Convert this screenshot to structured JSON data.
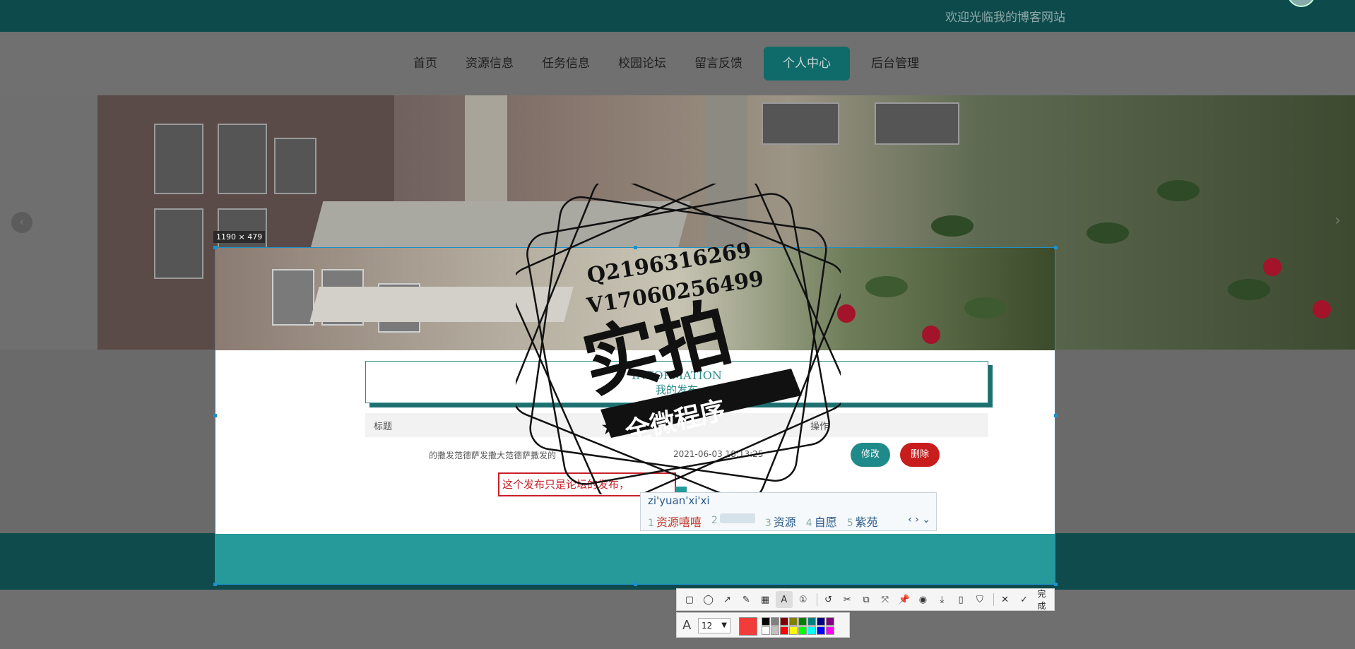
{
  "header": {
    "welcome": "欢迎光临我的博客网站"
  },
  "nav": {
    "items": [
      {
        "label": "首页"
      },
      {
        "label": "资源信息"
      },
      {
        "label": "任务信息"
      },
      {
        "label": "校园论坛"
      },
      {
        "label": "留言反馈"
      },
      {
        "label": "个人中心",
        "active": true
      },
      {
        "label": "后台管理"
      }
    ]
  },
  "selection": {
    "dimensions": "1190 × 479"
  },
  "info": {
    "title_en": "INFORMATION",
    "title_cn": "我的发布"
  },
  "table": {
    "headers": [
      "标题",
      "操作"
    ],
    "row": {
      "title": "的撒发范德萨发撒大范德萨撒发的",
      "date": "2021-06-03 18:13:25",
      "edit_label": "修改",
      "delete_label": "删除"
    }
  },
  "annotation_text": "这个发布只是论坛的发布，",
  "ime": {
    "input": "zi'yuan'xi'xi",
    "candidates": [
      {
        "num": "1",
        "text": "资源嘻嘻"
      },
      {
        "num": "2",
        "text": ""
      },
      {
        "num": "3",
        "text": "资源"
      },
      {
        "num": "4",
        "text": "自愿"
      },
      {
        "num": "5",
        "text": "紫苑"
      }
    ]
  },
  "watermark": {
    "line1": "Q2196316269",
    "line2": "V17060256499",
    "main": "实拍",
    "banner": "全微程序"
  },
  "toolbar": {
    "tools": [
      "rectangle-icon",
      "ellipse-icon",
      "arrow-icon",
      "pen-icon",
      "mosaic-icon",
      "text-icon",
      "number-icon"
    ],
    "actions": [
      "undo-icon",
      "ocr-icon",
      "translate-icon",
      "scroll-capture-icon",
      "pin-icon",
      "record-icon",
      "download-icon",
      "phone-icon",
      "bookmark-icon"
    ],
    "cancel": "close-icon",
    "done_label": "完成"
  },
  "propbar": {
    "font_size": "12",
    "current_color": "#f23b3b",
    "palette": [
      "#000000",
      "#808080",
      "#800000",
      "#808000",
      "#008000",
      "#008080",
      "#000080",
      "#800080",
      "#ffffff",
      "#c0c0c0",
      "#ff0000",
      "#ffff00",
      "#00ff00",
      "#00ffff",
      "#0000ff",
      "#ff00ff"
    ]
  }
}
